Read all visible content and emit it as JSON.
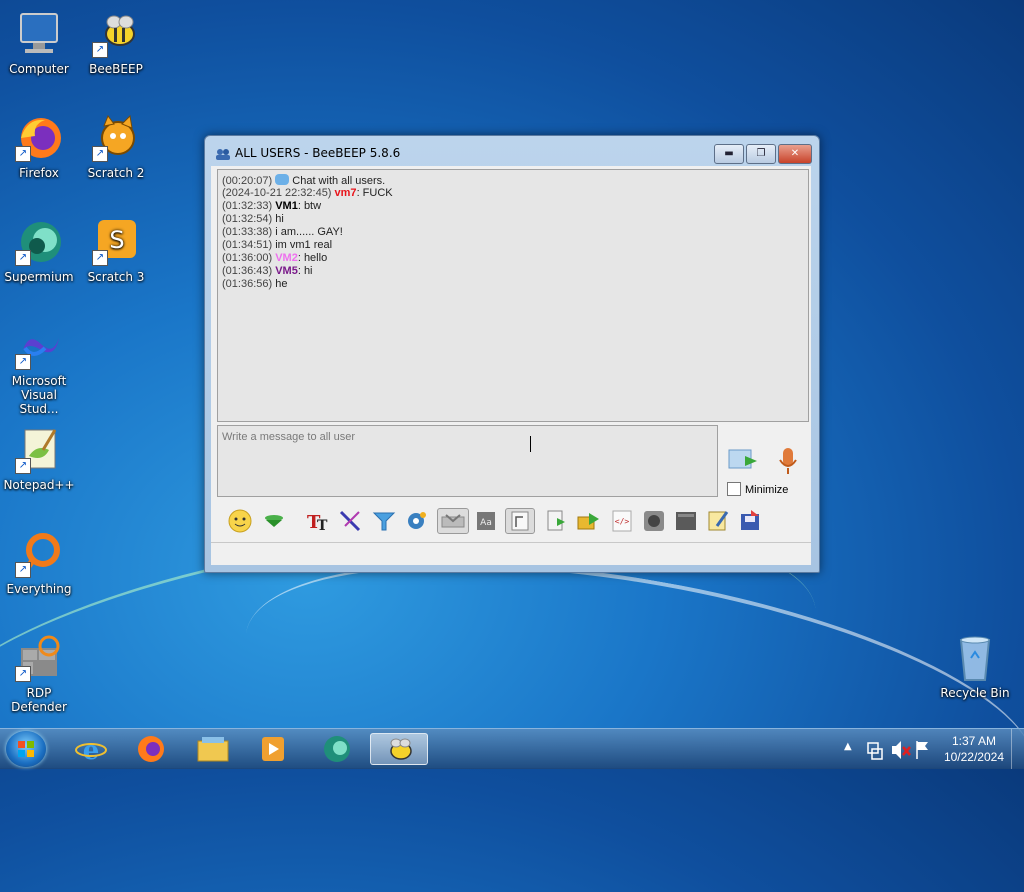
{
  "desktop": {
    "icons": [
      {
        "label": "Computer"
      },
      {
        "label": "BeeBEEP"
      },
      {
        "label": "Firefox"
      },
      {
        "label": "Scratch 2"
      },
      {
        "label": "Supermium"
      },
      {
        "label": "Scratch 3"
      },
      {
        "label": "Microsoft Visual Stud..."
      },
      {
        "label": "Notepad++"
      },
      {
        "label": "Everything"
      },
      {
        "label": "RDP Defender"
      },
      {
        "label": "Recycle Bin"
      }
    ]
  },
  "window": {
    "title": "ALL USERS - BeeBEEP 5.8.6",
    "controls": {
      "minimize": "▬",
      "maximize": "❐",
      "close": "✕"
    }
  },
  "chat": {
    "lines": [
      {
        "ts": "(00:20:07)",
        "user": "",
        "text": "Chat with all users."
      },
      {
        "ts": "(2024-10-21 22:32:45)",
        "user": "vm7",
        "text": ": FUCK"
      },
      {
        "ts": "(01:32:33)",
        "user": "VM1",
        "text": ": btw"
      },
      {
        "ts": "(01:32:54)",
        "user": "",
        "text": "hi"
      },
      {
        "ts": "(01:33:38)",
        "user": "",
        "text": "i am...... GAY!"
      },
      {
        "ts": "(01:34:51)",
        "user": "",
        "text": "im vm1 real"
      },
      {
        "ts": "(01:36:00)",
        "user": "VM2",
        "text": ": hello"
      },
      {
        "ts": "(01:36:43)",
        "user": "VM5",
        "text": ": hi"
      },
      {
        "ts": "(01:36:56)",
        "user": "",
        "text": "he"
      }
    ],
    "colors": {
      "vm7": "#e8141b",
      "VM1": "#000000",
      "VM2": "#ee70ee",
      "VM5": "#7a1a8a"
    }
  },
  "compose": {
    "placeholder": "Write a message to all user",
    "minimize_label": "Minimize"
  },
  "taskbar": {
    "time": "1:37 AM",
    "date": "10/22/2024"
  }
}
